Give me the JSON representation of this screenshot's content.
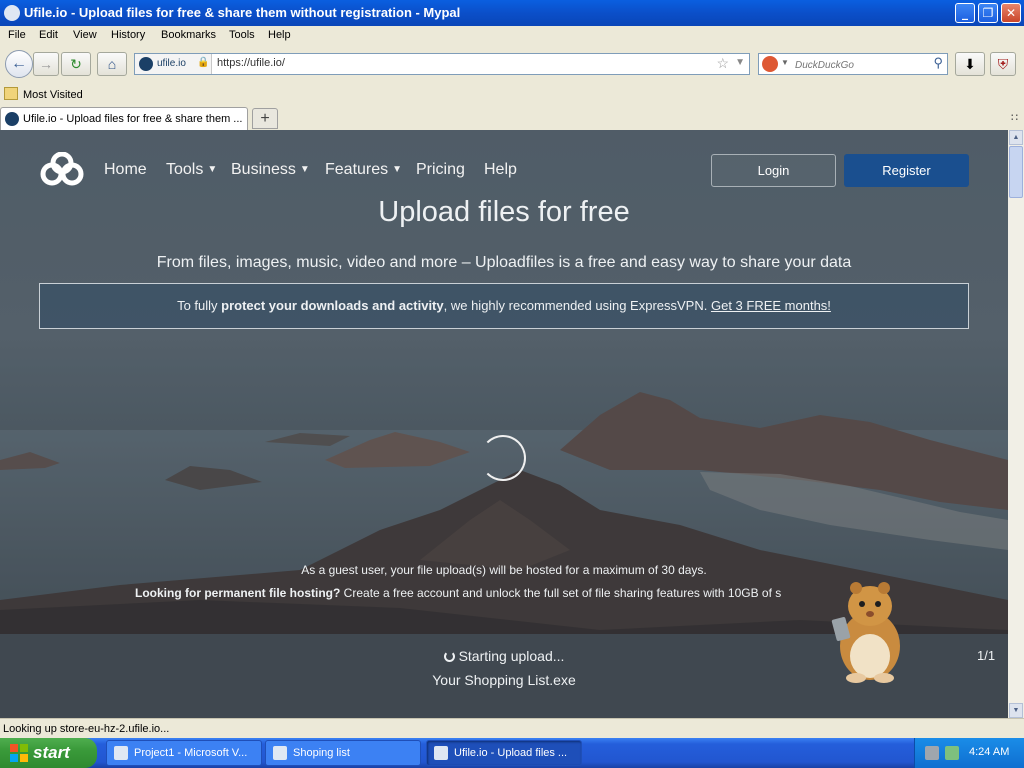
{
  "window": {
    "title": "Ufile.io - Upload files for free & share them without registration - Mypal",
    "minimize_glyph": "_",
    "maximize_glyph": "❐",
    "close_glyph": "✕"
  },
  "menu": [
    "File",
    "Edit",
    "View",
    "History",
    "Bookmarks",
    "Tools",
    "Help"
  ],
  "navbar": {
    "identity_site": "ufile.io",
    "url": "https://ufile.io/",
    "search_placeholder": "DuckDuckGo",
    "icons": [
      "back-icon",
      "forward-icon",
      "reload-icon",
      "home-icon",
      "lock-icon",
      "bookmark-star-icon",
      "search-icon",
      "download-icon",
      "ublock-icon"
    ]
  },
  "bookmarks": {
    "most_visited": "Most Visited"
  },
  "tabs": [
    {
      "label": "Ufile.io - Upload files for free & share them ..."
    }
  ],
  "page": {
    "nav": {
      "home": "Home",
      "tools": "Tools",
      "business": "Business",
      "features": "Features",
      "pricing": "Pricing",
      "help": "Help"
    },
    "login": "Login",
    "register": "Register",
    "hero_title": "Upload files for free",
    "hero_subtitle": "From files, images, music, video and more – Uploadfiles is a free and easy way to share your data",
    "vpn": {
      "prefix": "To fully ",
      "bold": "protect your downloads and activity",
      "middle": ", we highly recommended using ExpressVPN. ",
      "link": "Get 3 FREE months!"
    },
    "guest_note": "As a guest user, your file upload(s) will be hosted for a maximum of 30 days.",
    "perm_note": {
      "bold": "Looking for permanent file hosting?",
      "text": " Create a free account and unlock the full set of file sharing features with 10GB of s"
    },
    "upload": {
      "status": "Starting upload...",
      "file": "Your Shopping List.exe",
      "count": "1/1"
    }
  },
  "statusbar": {
    "text": "Looking up store-eu-hz-2.ufile.io..."
  },
  "taskbar": {
    "start": "start",
    "items": [
      {
        "label": "Project1 - Microsoft V..."
      },
      {
        "label": "Shoping list"
      },
      {
        "label": "Ufile.io - Upload files ..."
      }
    ],
    "clock": "4:24 AM"
  },
  "colors": {
    "register_button": "#1a4f8f",
    "xp_titlebar": "#0b4fc9",
    "xp_start": "#3a9a3a"
  }
}
